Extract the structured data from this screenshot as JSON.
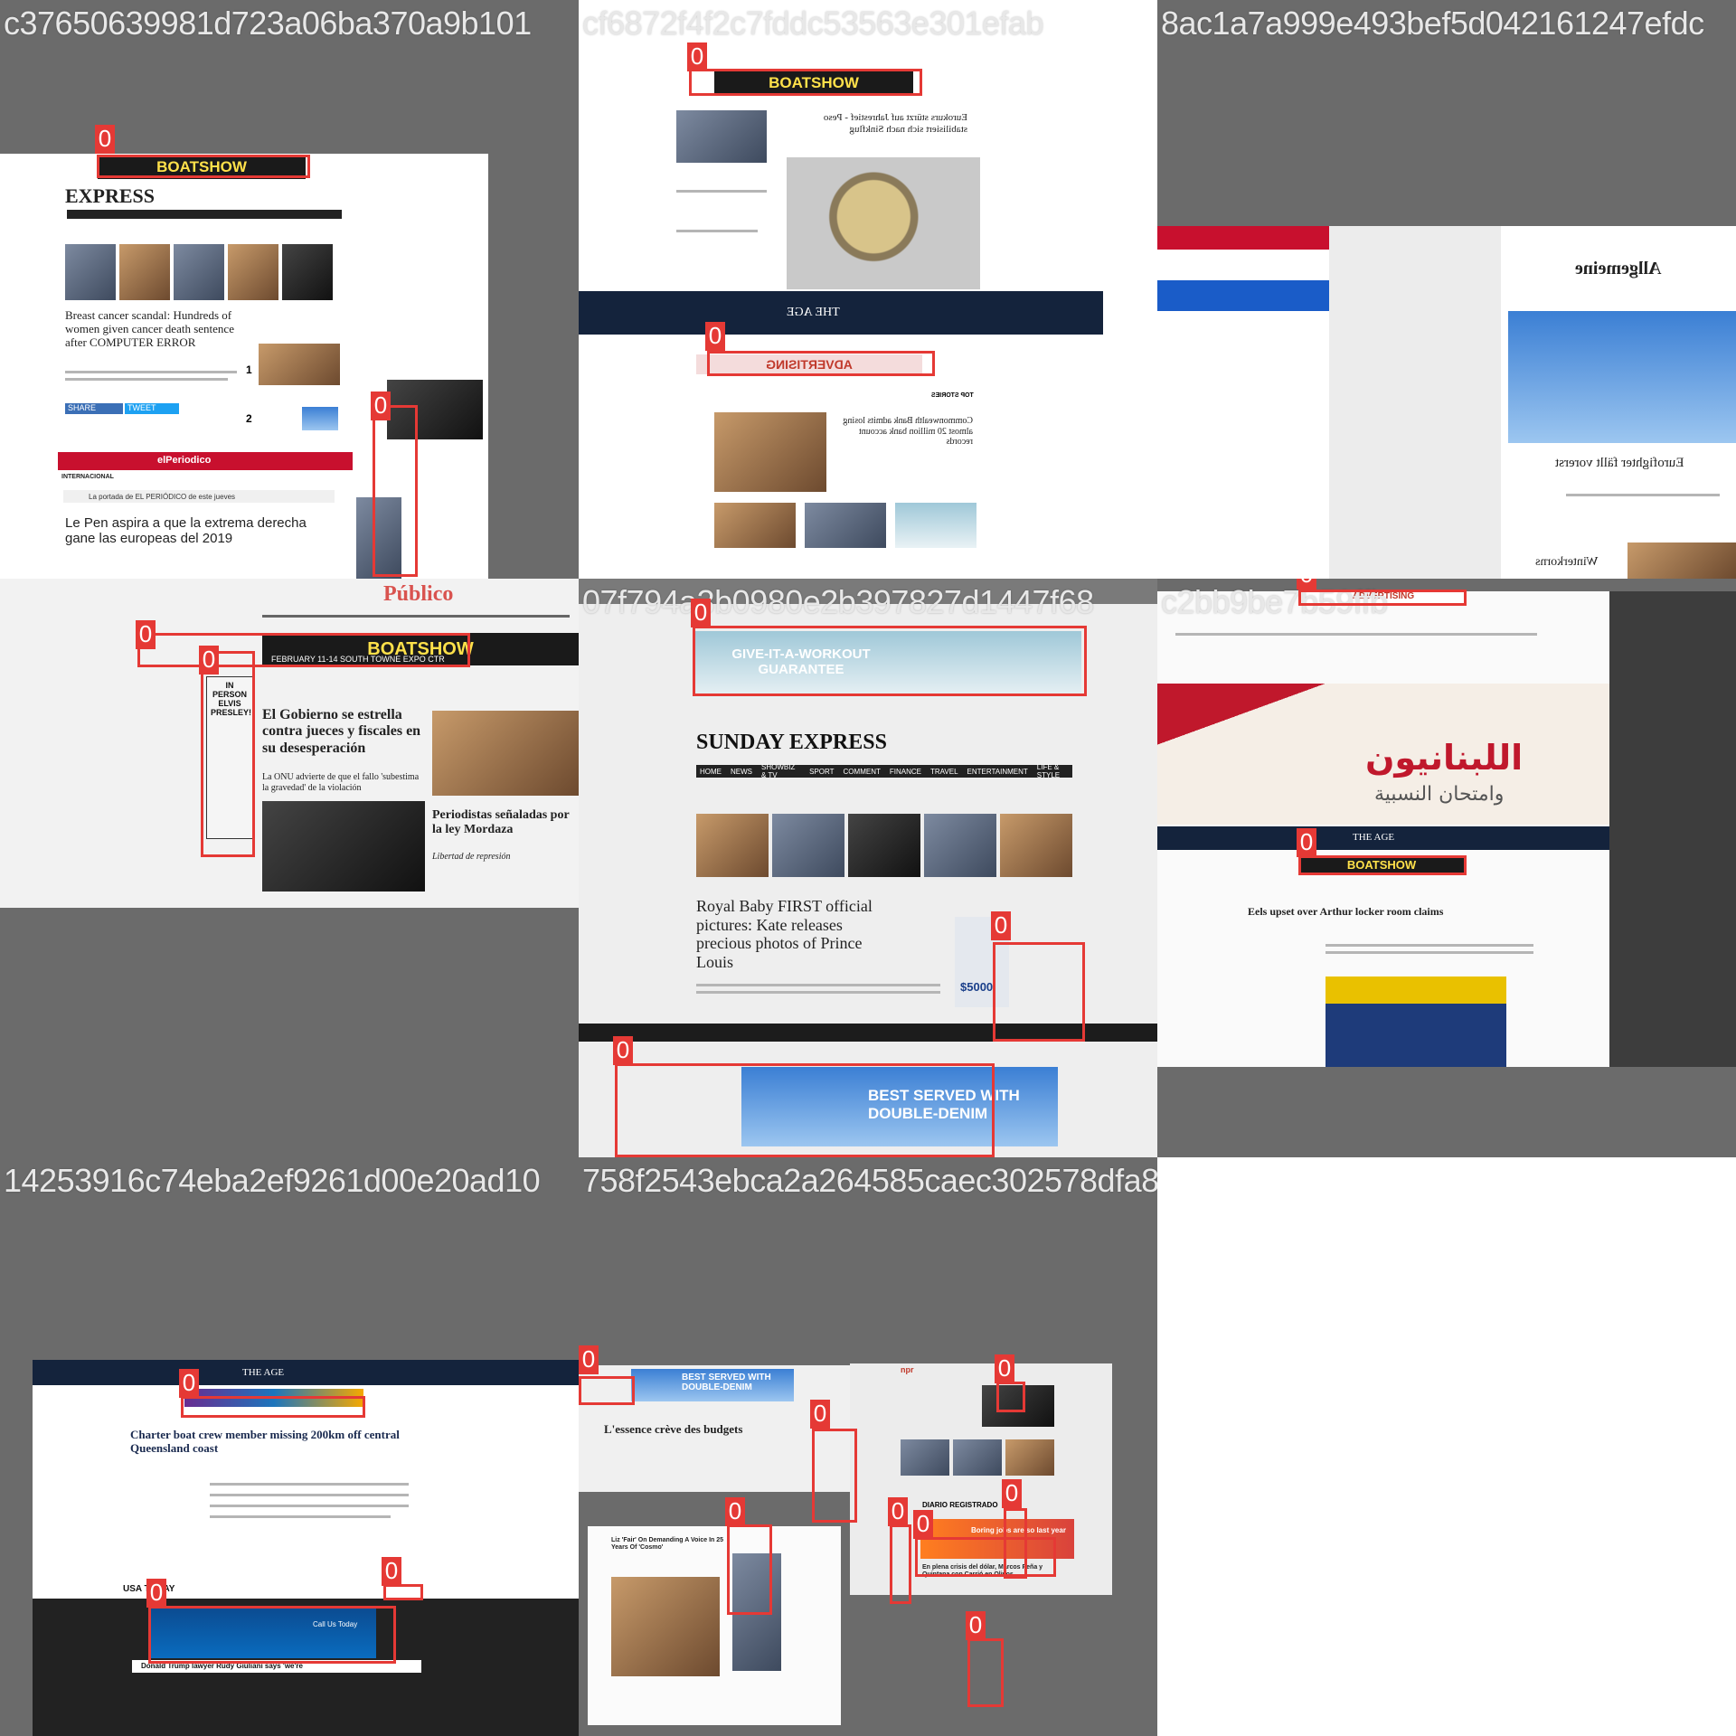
{
  "tiles": [
    {
      "id": "c37650639981d723a06ba370a9b101",
      "detections": [
        "0",
        "0"
      ],
      "texts": {
        "banner": "BOATSHOW",
        "masthead": "EXPRESS",
        "headline": "Breast cancer scandal: Hundreds of women given cancer death sentence after COMPUTER ERROR",
        "section": "INTERNACIONAL",
        "masthead2": "elPeriodico",
        "subhead": "La portada de EL PERIÓDICO de este jueves",
        "headline2": "Le Pen aspira a que la extrema derecha gane las europeas del 2019",
        "share": "SHARE",
        "tweet": "TWEET",
        "rank1": "1",
        "rank2": "2"
      }
    },
    {
      "id": "cf6872f4f2c7fddc53563e301efab",
      "detections": [
        "0",
        "0"
      ],
      "texts": {
        "banner": "BOATSHOW",
        "headline": "Eurokurs stürzt auf Jahrestief - Peso stabilisiert sich nach Sinkflug",
        "masthead": "THE AGE",
        "ad": "ADVERTISING",
        "top": "TOP STORIES",
        "headline2": "Commonwealth Bank admits losing almost 20 million bank account records"
      }
    },
    {
      "id": "8ac1a7a999e493bef5d042161247efdc",
      "detections": [],
      "texts": {
        "masthead": "Allgemeine",
        "headline": "Eurofighter fällt vorerst",
        "footer": "Winterkorns"
      }
    },
    {
      "id": "",
      "detections": [
        "0",
        "0"
      ],
      "texts": {
        "masthead": "Público",
        "banner": "BOATSHOW",
        "banner_sub": "FEBRUARY 11-14 SOUTH TOWNE EXPO CTR",
        "side_ad": "IN PERSON ELVIS PRESLEY!",
        "headline": "El Gobierno se estrella contra jueces y fiscales en su desesperación",
        "sub": "La ONU advierte de que el fallo 'subestima la gravedad' de la violación",
        "headline2": "Periodistas señaladas por la ley Mordaza",
        "sub2": "Libertad de represión"
      }
    },
    {
      "id": "07f794a3b0980e2b397827d1447f68",
      "detections": [
        "0",
        "0",
        "0"
      ],
      "texts": {
        "ad_top": "GIVE-IT-A-WORKOUT GUARANTEE",
        "masthead": "SUNDAY EXPRESS",
        "nav": [
          "HOME",
          "NEWS",
          "SHOWBIZ & TV",
          "SPORT",
          "COMMENT",
          "FINANCE",
          "TRAVEL",
          "ENTERTAINMENT",
          "LIFE & STYLE"
        ],
        "headline": "Royal Baby FIRST official pictures: Kate releases precious photos of Prince Louis",
        "ad_bottom": "BEST SERVED WITH DOUBLE-DENIM",
        "car_price": "$5000"
      }
    },
    {
      "id": "c2bb9be7b59ffb",
      "detections": [
        "0",
        "0"
      ],
      "texts": {
        "banner_top": "ADVERTISING",
        "arabic_title": "اللبنانيون",
        "arabic_sub": "وامتحان النسبية",
        "masthead": "THE AGE",
        "banner": "BOATSHOW",
        "headline": "Eels upset over Arthur locker room claims"
      }
    },
    {
      "id": "14253916c74eba2ef9261d00e20ad10",
      "detections": [
        "0",
        "0",
        "0"
      ],
      "texts": {
        "masthead": "THE AGE",
        "headline": "Charter boat crew member missing 200km off central Queensland coast",
        "usa": "USA TODAY",
        "ad": "Call Us Today",
        "headline2": "Donald Trump lawyer Rudy Giuliani says 'we're"
      }
    },
    {
      "id": "758f2543ebca2a264585caec302578dfa8e686a2",
      "detections": [
        "0",
        "0",
        "0",
        "0",
        "0",
        "0",
        "0",
        "0"
      ],
      "texts": {
        "ad_banner": "BEST SERVED WITH DOUBLE-DENIM",
        "headline": "L'essence crève des budgets",
        "npr": "npr",
        "podcast": "Liz 'Fair' On Demanding A Voice In 25 Years Of 'Cosmo'",
        "diario": "DIARIO REGISTRADO",
        "jobs": "Boring jobs are so last year",
        "headline2": "En plena crisis del dólar, Marcos Peña y Quintana con Carrió en Olivos"
      }
    },
    {
      "id": "",
      "detections": [],
      "texts": {}
    }
  ]
}
